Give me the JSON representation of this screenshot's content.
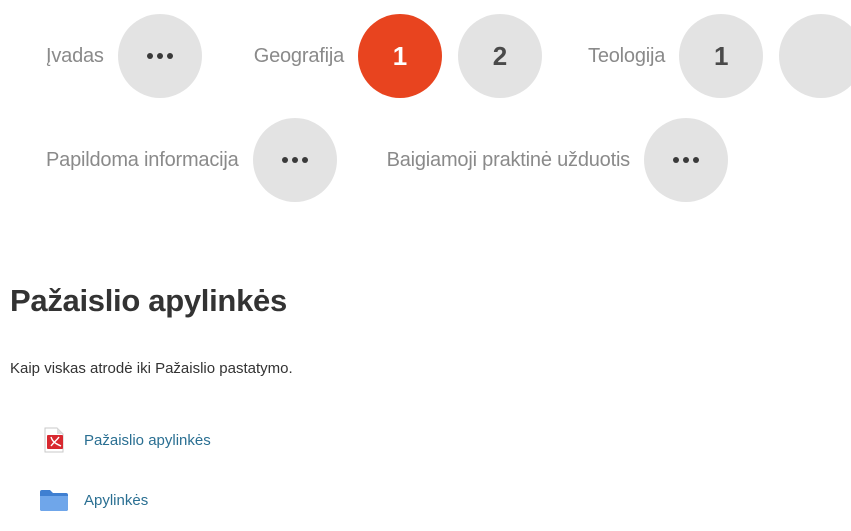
{
  "section_nav": {
    "row1": [
      {
        "label": "Įvadas",
        "button": "•••",
        "active": false
      },
      {
        "label": "Geografija",
        "buttons": [
          {
            "text": "1",
            "active": true
          },
          {
            "text": "2",
            "active": false
          }
        ]
      },
      {
        "label": "Teologija",
        "buttons": [
          {
            "text": "1",
            "active": false
          }
        ]
      }
    ],
    "row2": [
      {
        "label": "Papildoma informacija",
        "button": "•••"
      },
      {
        "label": "Baigiamoji praktinė užduotis",
        "button": "•••"
      }
    ]
  },
  "section": {
    "title": "Pažaislio apylinkės",
    "summary": "Kaip viskas atrodė iki Pažaislio pastatymo."
  },
  "resources": [
    {
      "label": "Pažaislio apylinkės",
      "icon": "pdf-file-icon"
    },
    {
      "label": "Apylinkės",
      "icon": "folder-icon"
    }
  ],
  "colors": {
    "accent": "#e8441f",
    "circle_bg": "#e3e3e3",
    "link": "#2a6f92",
    "text": "#333333",
    "muted_text": "#8a8a8a"
  }
}
